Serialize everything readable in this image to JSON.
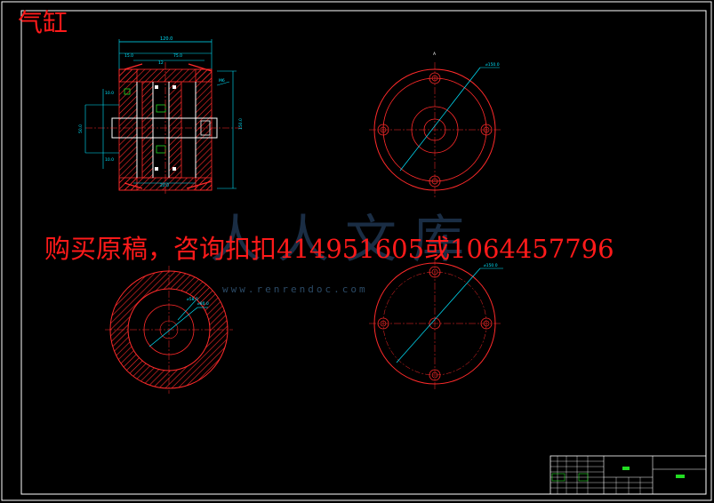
{
  "drawing": {
    "title": "气缸",
    "watermark": "购买原稿，咨询扣扣414951605或1064457796",
    "watermark_logo": "人人文库",
    "watermark_url": "www.renrendoc.com"
  },
  "colors": {
    "background": "#000000",
    "frame": "#ffffff",
    "part_red": "#ff2a2a",
    "dimension_cyan": "#00e5ff",
    "green": "#22dd22",
    "text_red": "#ff1a1a"
  }
}
